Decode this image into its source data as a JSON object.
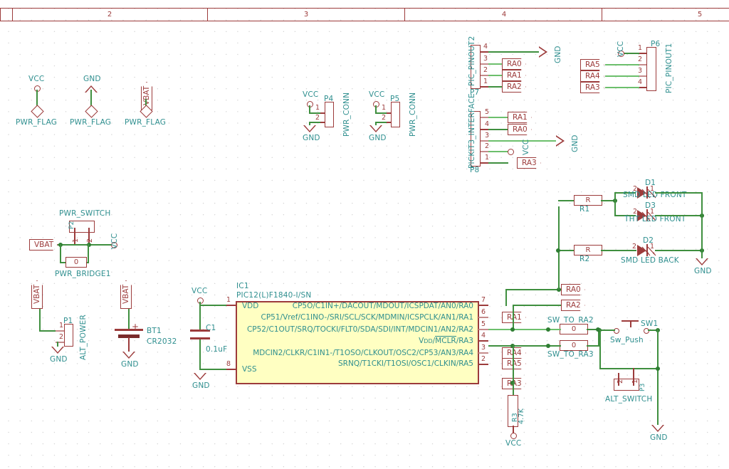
{
  "sheet": {
    "ruler_labels": [
      "2",
      "3",
      "4",
      "5"
    ]
  },
  "power_flags": [
    {
      "net": "VCC",
      "label": "PWR_FLAG",
      "port_type": "circle"
    },
    {
      "net": "GND",
      "label": "PWR_FLAG",
      "port_type": "arrow-up"
    },
    {
      "net": "VBAT",
      "label": "PWR_FLAG",
      "port_type": "net-flag"
    }
  ],
  "connectors": [
    {
      "ref": "P4",
      "name": "PWR_CONN",
      "pins": [
        "1",
        "2"
      ],
      "nets": [
        "VCC",
        "GND"
      ]
    },
    {
      "ref": "P5",
      "name": "PWR_CONN",
      "pins": [
        "1",
        "2"
      ],
      "nets": [
        "VCC",
        "GND"
      ]
    },
    {
      "ref": "P7",
      "name": "PIC_PINOUT2",
      "pins": [
        "4",
        "3",
        "2",
        "1"
      ],
      "nets": [
        "GND",
        "RA0",
        "RA1",
        "RA2"
      ]
    },
    {
      "ref": "P8",
      "name": "PICKIT3_INTERFACE",
      "pins": [
        "5",
        "4",
        "3",
        "2",
        "1"
      ],
      "nets": [
        "RA1",
        "RA0",
        "GND",
        "VCC",
        "RA3"
      ]
    },
    {
      "ref": "P6",
      "name": "PIC_PINOUT1",
      "pins": [
        "1",
        "2",
        "3",
        "4"
      ],
      "nets": [
        "VCC",
        "RA5",
        "RA4",
        "RA3"
      ]
    },
    {
      "ref": "P1",
      "name": "ALT_POWER",
      "pins": [
        "1",
        "2"
      ],
      "nets": [
        "VBAT",
        "GND"
      ]
    },
    {
      "ref": "P2",
      "name": "PWR_SWITCH",
      "pins": [
        "1",
        "2"
      ],
      "nets": [
        "VBAT",
        "VCC"
      ]
    },
    {
      "ref": "P3",
      "name": "ALT_SWITCH",
      "pins": [
        "1",
        "2"
      ],
      "nets": [
        "",
        "GND"
      ]
    }
  ],
  "ic": {
    "ref": "IC1",
    "value": "PIC12(L)F1840-I/SN",
    "left_pins": [
      {
        "num": "1",
        "label": "VDD"
      },
      {
        "num": "8",
        "label": "VSS"
      }
    ],
    "right_pins": [
      {
        "num": "7",
        "label": "CP5O/C1IN+/DACOUT/MDOUT/ICSPDAT/AN0/RA0"
      },
      {
        "num": "6",
        "label": "CP51/Vref/C1INO-/SRI/SCL/SCK/MDMIN/ICSPCLK/AN1/RA1"
      },
      {
        "num": "5",
        "label": "CP52/C1OUT/SRQ/TOCKI/FLT0/SDA/SDI/INT/MDCIN1/AN2/RA2"
      },
      {
        "num": "4",
        "label": "Vpp/MCLR/RA3",
        "overline": "MCLR"
      },
      {
        "num": "3",
        "label": "MDCIN2/CLKR/C1IN1-/T1OSO/CLKOUT/OSC2/CP53/AN3/RA4"
      },
      {
        "num": "2",
        "label": "SRNQ/T1CKI/T1OSI/OSC1/CLKIN/RA5"
      }
    ]
  },
  "passives": [
    {
      "ref": "C1",
      "value": "0.1uF",
      "type": "capacitor"
    },
    {
      "ref": "BT1",
      "value": "CR2032",
      "type": "battery"
    },
    {
      "ref": "R1",
      "value": "R",
      "type": "resistor"
    },
    {
      "ref": "R2",
      "value": "R",
      "type": "resistor"
    },
    {
      "ref": "R3",
      "value": "4.7K",
      "type": "resistor"
    },
    {
      "ref": "SW_TO_RA2",
      "value": "0",
      "type": "jumper"
    },
    {
      "ref": "SW_TO_RA3",
      "value": "0",
      "type": "jumper"
    },
    {
      "ref": "PWR_BRIDGE1",
      "value": "0",
      "type": "jumper"
    }
  ],
  "leds": [
    {
      "ref": "D1",
      "value": "SMD LED FRONT",
      "pins": [
        "2",
        "1"
      ]
    },
    {
      "ref": "D3",
      "value": "THT LED FRONT",
      "pins": [
        "2",
        "1"
      ]
    },
    {
      "ref": "D2",
      "value": "SMD LED BACK",
      "pins": [
        "2",
        "1"
      ]
    }
  ],
  "switches": [
    {
      "ref": "SW1",
      "value": "Sw_Push"
    }
  ],
  "net_labels": {
    "ra0": "RA0",
    "ra1": "RA1",
    "ra2": "RA2",
    "ra3": "RA3",
    "ra4": "RA4",
    "ra5": "RA5",
    "vbat": "VBAT",
    "vcc": "VCC",
    "gnd": "GND"
  },
  "colors": {
    "wire": "#3f8f3f",
    "component": "#9c3b3b",
    "label": "#2f8f8f",
    "ic_fill": "#ffffc2",
    "background": "#ffffff",
    "grid_dot": "#c9c9c9"
  }
}
